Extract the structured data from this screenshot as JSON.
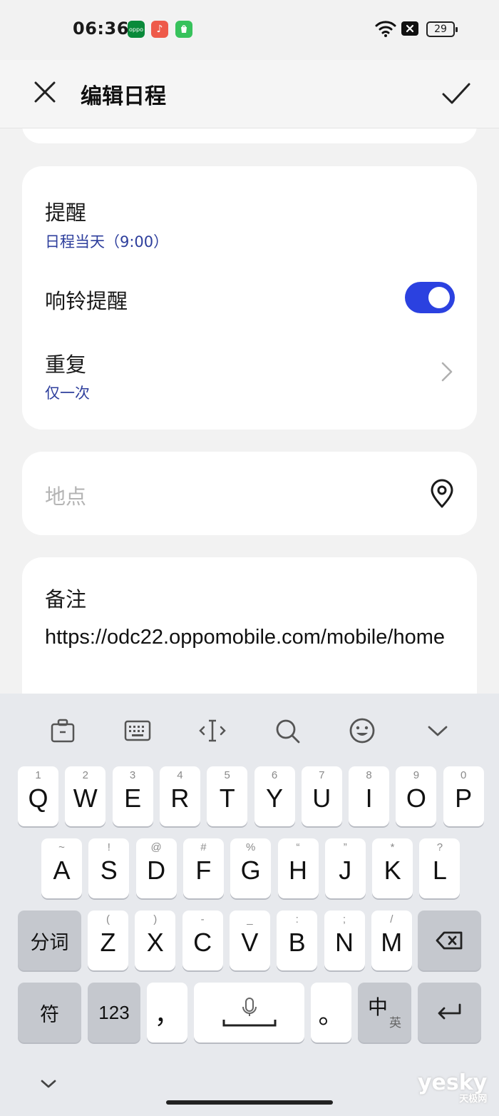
{
  "status_bar": {
    "time": "06:36",
    "battery": "29",
    "apps": [
      {
        "icon": "oppo-app-icon",
        "label": "oppo",
        "color": "#0a8a3a"
      },
      {
        "icon": "music-app-icon",
        "label": "♪",
        "color": "#ee5a4a"
      },
      {
        "icon": "store-app-icon",
        "label": "",
        "color": "#37c25c"
      }
    ]
  },
  "header": {
    "title": "编辑日程"
  },
  "reminder": {
    "label": "提醒",
    "value": "日程当天（9:00）",
    "ring_label": "响铃提醒",
    "ring_enabled": true,
    "repeat_label": "重复",
    "repeat_value": "仅一次"
  },
  "location": {
    "placeholder": "地点"
  },
  "notes": {
    "label": "备注",
    "text": "https://odc22.oppomobile.com/mobile/home"
  },
  "keyboard": {
    "toolbar": [
      "clipboard-icon",
      "keyboard-icon",
      "cursor-icon",
      "search-icon",
      "emoji-icon",
      "collapse-icon"
    ],
    "row1": [
      {
        "k": "Q",
        "h": "1"
      },
      {
        "k": "W",
        "h": "2"
      },
      {
        "k": "E",
        "h": "3"
      },
      {
        "k": "R",
        "h": "4"
      },
      {
        "k": "T",
        "h": "5"
      },
      {
        "k": "Y",
        "h": "6"
      },
      {
        "k": "U",
        "h": "7"
      },
      {
        "k": "I",
        "h": "8"
      },
      {
        "k": "O",
        "h": "9"
      },
      {
        "k": "P",
        "h": "0"
      }
    ],
    "row2": [
      {
        "k": "A",
        "h": "~"
      },
      {
        "k": "S",
        "h": "!"
      },
      {
        "k": "D",
        "h": "@"
      },
      {
        "k": "F",
        "h": "#"
      },
      {
        "k": "G",
        "h": "%"
      },
      {
        "k": "H",
        "h": "“"
      },
      {
        "k": "J",
        "h": "”"
      },
      {
        "k": "K",
        "h": "*"
      },
      {
        "k": "L",
        "h": "?"
      }
    ],
    "row3": [
      {
        "k": "Z",
        "h": "("
      },
      {
        "k": "X",
        "h": ")"
      },
      {
        "k": "C",
        "h": "-"
      },
      {
        "k": "V",
        "h": "_"
      },
      {
        "k": "B",
        "h": ":"
      },
      {
        "k": "N",
        "h": ";"
      },
      {
        "k": "M",
        "h": "/"
      }
    ],
    "segment_label": "分词",
    "symbol_label": "符",
    "numbers_label": "123",
    "comma_label": "，",
    "period_label": "。",
    "lang_main": "中",
    "lang_sub": "英"
  },
  "watermark": {
    "brand": "yesky",
    "sub": "天极网"
  }
}
